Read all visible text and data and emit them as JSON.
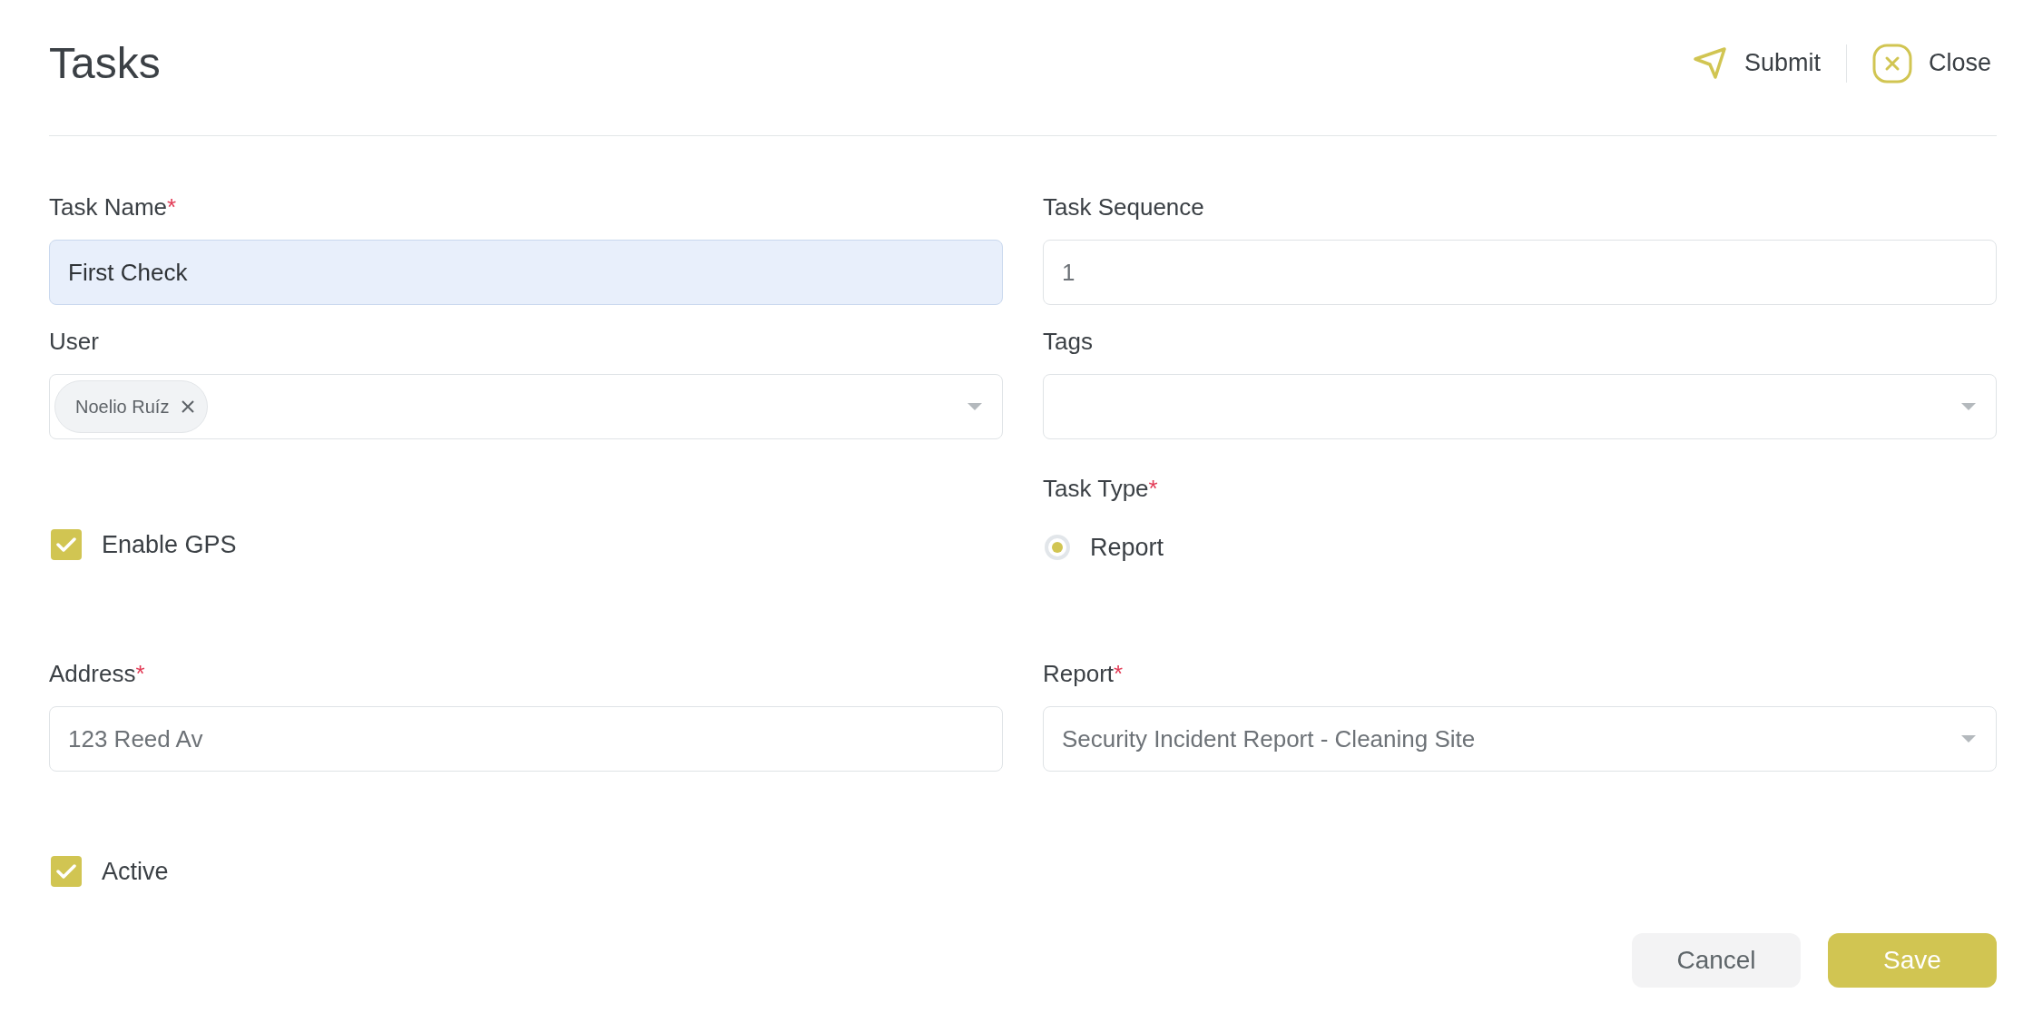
{
  "header": {
    "title": "Tasks",
    "actions": [
      {
        "kind": "submit",
        "label": "Submit"
      },
      {
        "kind": "close",
        "label": "Close"
      }
    ]
  },
  "task_name": {
    "label": "Task Name",
    "required_mark": "*",
    "value": "First Check",
    "focused": true
  },
  "task_sequence": {
    "label": "Task Sequence",
    "value": "1",
    "focused": false
  },
  "user": {
    "label": "User",
    "chips": [
      {
        "label": "Noelio Ruíz"
      }
    ]
  },
  "tags": {
    "label": "Tags"
  },
  "enable_gps": {
    "label": "Enable GPS",
    "checked": true
  },
  "task_type": {
    "label": "Task Type",
    "required_mark": "*",
    "options": [
      {
        "label": "Report",
        "selected": true
      }
    ]
  },
  "address": {
    "label": "Address",
    "required_mark": "*",
    "value": "123 Reed Av",
    "focused": false
  },
  "report": {
    "label": "Report",
    "required_mark": "*",
    "value": "Security Incident Report - Cleaning Site"
  },
  "active": {
    "label": "Active",
    "checked": true
  },
  "buttons": [
    {
      "kind": "secondary",
      "label": "Cancel"
    },
    {
      "kind": "primary",
      "label": "Save"
    }
  ]
}
